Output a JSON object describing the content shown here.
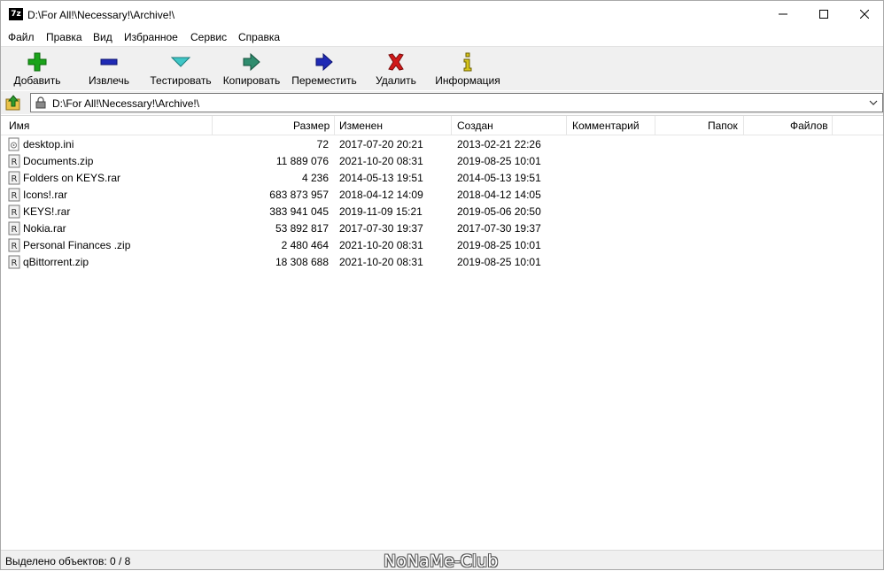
{
  "window": {
    "app_icon_text": "7z",
    "title": "D:\\For All!\\Necessary!\\Archive!\\"
  },
  "menu": [
    "Файл",
    "Правка",
    "Вид",
    "Избранное",
    "Сервис",
    "Справка"
  ],
  "toolbar": [
    {
      "label": "Добавить",
      "icon": "plus-icon",
      "color": "#1aa31a"
    },
    {
      "label": "Извлечь",
      "icon": "minus-icon",
      "color": "#1f2ab5"
    },
    {
      "label": "Тестировать",
      "icon": "check-icon",
      "color": "#3fc6c6"
    },
    {
      "label": "Копировать",
      "icon": "copy-arrow-icon",
      "color": "#2f8c6e"
    },
    {
      "label": "Переместить",
      "icon": "move-arrow-icon",
      "color": "#1f2ab5"
    },
    {
      "label": "Удалить",
      "icon": "delete-x-icon",
      "color": "#d11a1a"
    },
    {
      "label": "Информация",
      "icon": "info-icon",
      "color": "#d6c41a"
    }
  ],
  "address": {
    "path": "D:\\For All!\\Necessary!\\Archive!\\"
  },
  "columns": [
    "Имя",
    "Размер",
    "Изменен",
    "Создан",
    "Комментарий",
    "Папок",
    "Файлов"
  ],
  "files": [
    {
      "name": "desktop.ini",
      "size": "72",
      "modified": "2017-07-20 20:21",
      "created": "2013-02-21 22:26",
      "icon": "settings-file-icon"
    },
    {
      "name": "Documents.zip",
      "size": "11 889 076",
      "modified": "2021-10-20 08:31",
      "created": "2019-08-25 10:01",
      "icon": "archive-file-icon"
    },
    {
      "name": "Folders on KEYS.rar",
      "size": "4 236",
      "modified": "2014-05-13 19:51",
      "created": "2014-05-13 19:51",
      "icon": "archive-file-icon"
    },
    {
      "name": "Icons!.rar",
      "size": "683 873 957",
      "modified": "2018-04-12 14:09",
      "created": "2018-04-12 14:05",
      "icon": "archive-file-icon"
    },
    {
      "name": "KEYS!.rar",
      "size": "383 941 045",
      "modified": "2019-11-09 15:21",
      "created": "2019-05-06 20:50",
      "icon": "archive-file-icon"
    },
    {
      "name": "Nokia.rar",
      "size": "53 892 817",
      "modified": "2017-07-30 19:37",
      "created": "2017-07-30 19:37",
      "icon": "archive-file-icon"
    },
    {
      "name": "Personal Finances .zip",
      "size": "2 480 464",
      "modified": "2021-10-20 08:31",
      "created": "2019-08-25 10:01",
      "icon": "archive-file-icon"
    },
    {
      "name": "qBittorrent.zip",
      "size": "18 308 688",
      "modified": "2021-10-20 08:31",
      "created": "2019-08-25 10:01",
      "icon": "archive-file-icon"
    }
  ],
  "status": {
    "selected": "Выделено объектов: 0 / 8",
    "watermark": "NoNaMe-Club"
  }
}
